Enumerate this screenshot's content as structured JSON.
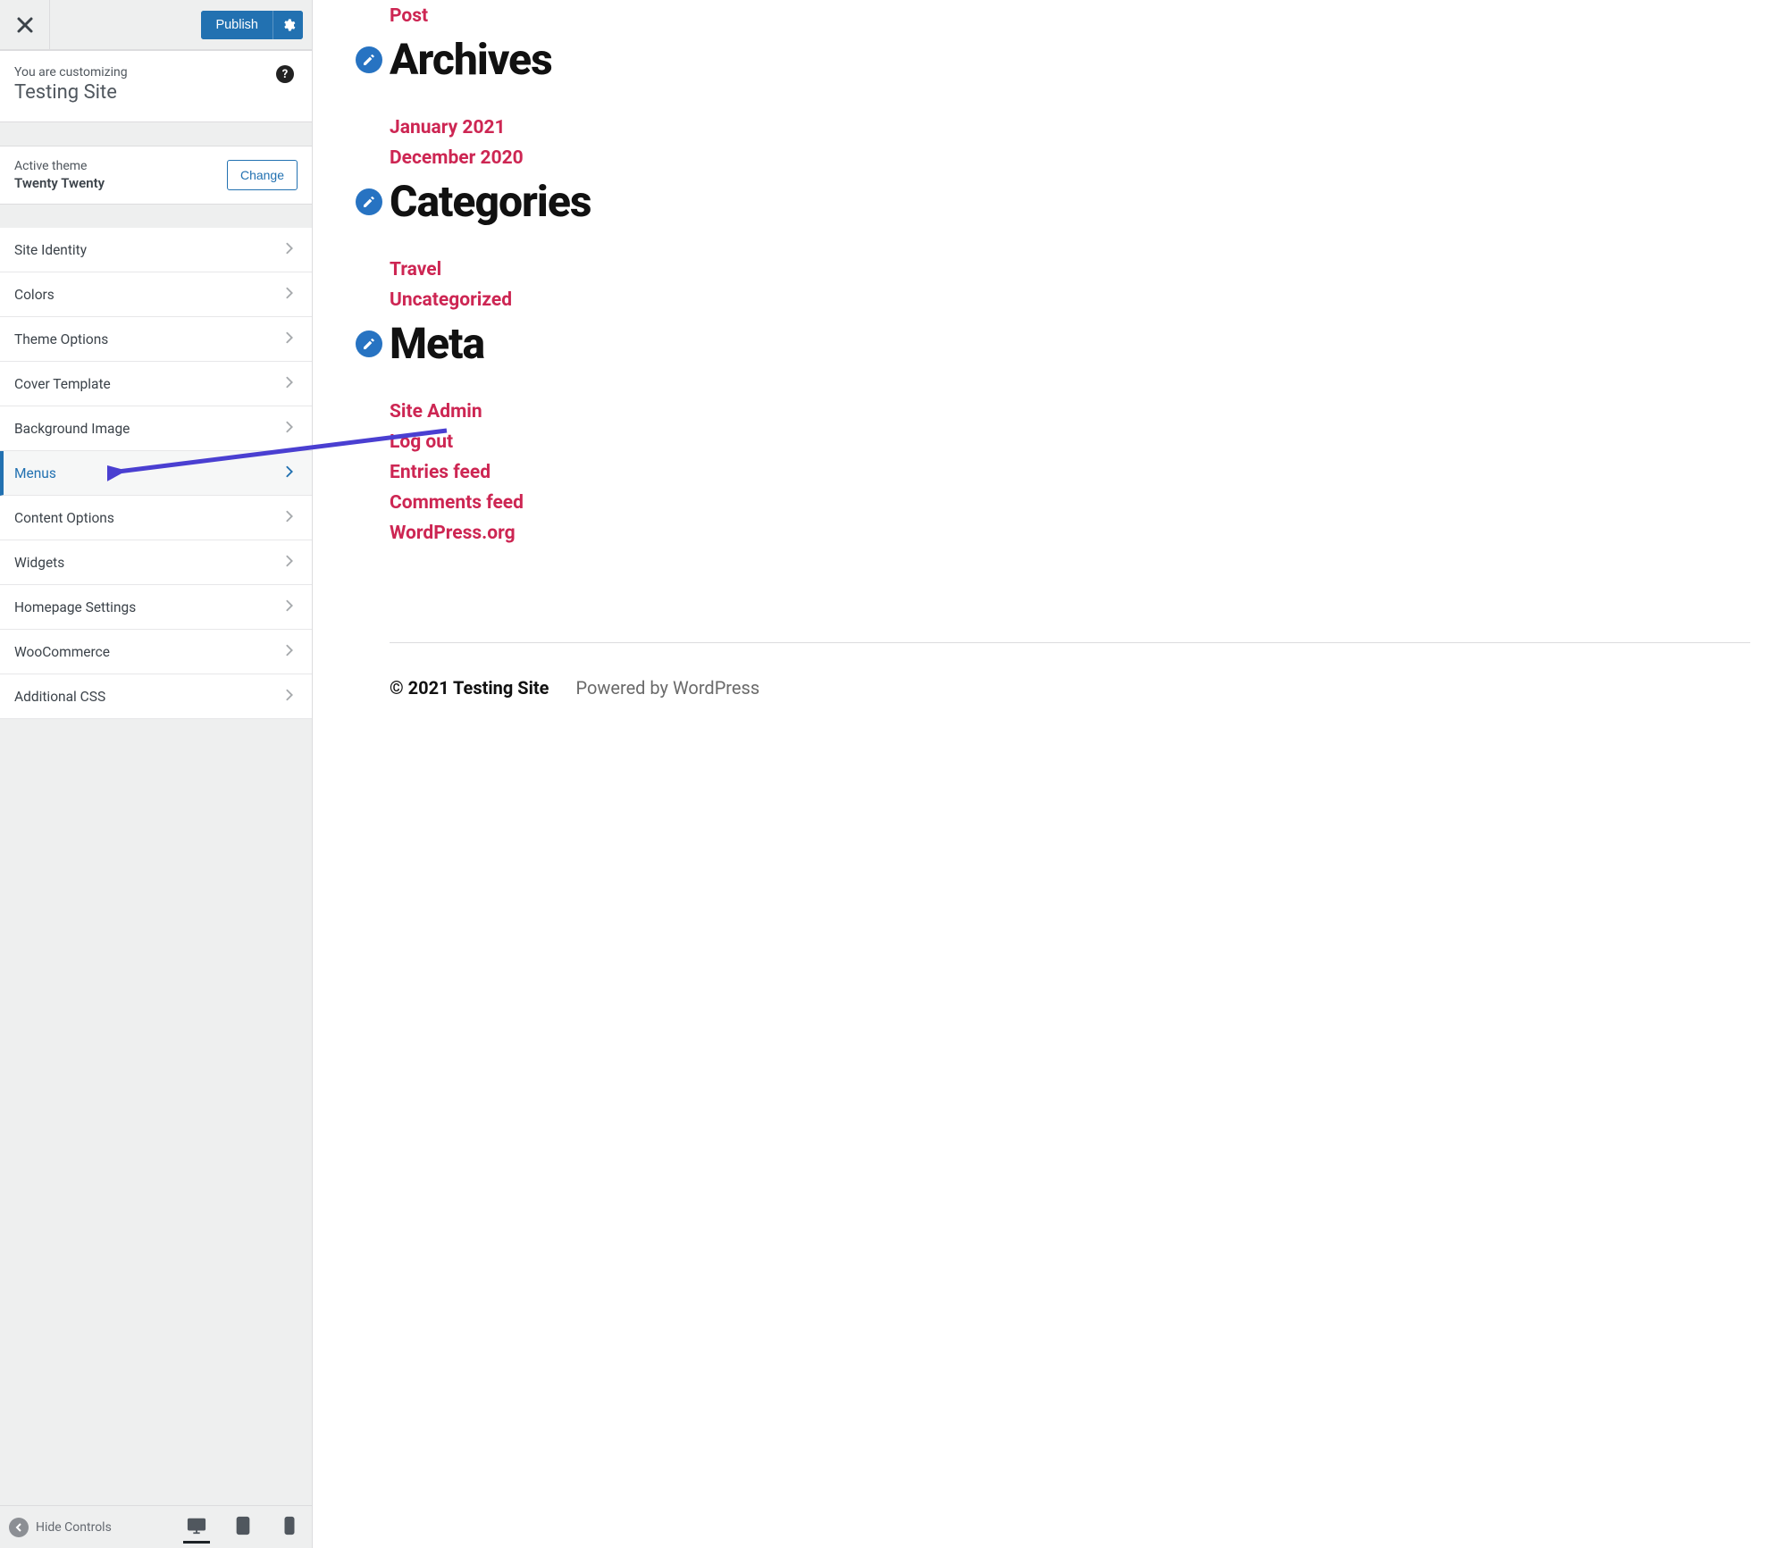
{
  "sidebar": {
    "publish_label": "Publish",
    "customizing_label": "You are customizing",
    "site_name": "Testing Site",
    "active_theme_label": "Active theme",
    "theme_name": "Twenty Twenty",
    "change_label": "Change",
    "items": [
      {
        "label": "Site Identity",
        "active": false
      },
      {
        "label": "Colors",
        "active": false
      },
      {
        "label": "Theme Options",
        "active": false
      },
      {
        "label": "Cover Template",
        "active": false
      },
      {
        "label": "Background Image",
        "active": false
      },
      {
        "label": "Menus",
        "active": true
      },
      {
        "label": "Content Options",
        "active": false
      },
      {
        "label": "Widgets",
        "active": false
      },
      {
        "label": "Homepage Settings",
        "active": false
      },
      {
        "label": "WooCommerce",
        "active": false
      },
      {
        "label": "Additional CSS",
        "active": false
      }
    ],
    "hide_controls_label": "Hide Controls"
  },
  "preview": {
    "post_link": "Post",
    "widgets": [
      {
        "title": "Archives",
        "links": [
          "January 2021",
          "December 2020"
        ]
      },
      {
        "title": "Categories",
        "links": [
          "Travel",
          "Uncategorized"
        ]
      },
      {
        "title": "Meta",
        "links": [
          "Site Admin",
          "Log out",
          "Entries feed",
          "Comments feed",
          "WordPress.org"
        ]
      }
    ],
    "footer_copyright": "© 2021 Testing Site",
    "footer_powered": "Powered by WordPress"
  }
}
